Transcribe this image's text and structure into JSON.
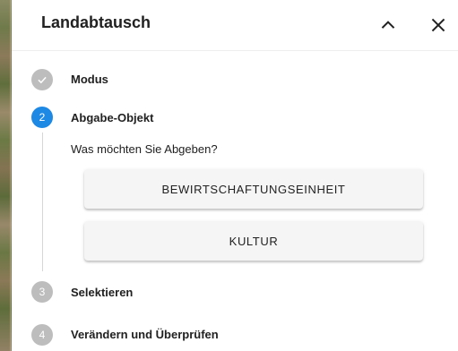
{
  "panel": {
    "title": "Landabtausch"
  },
  "header_icons": {
    "collapse": "chevron-up-icon",
    "close": "close-icon"
  },
  "stepper": {
    "steps": [
      {
        "marker": "",
        "icon": "check-icon",
        "label": "Modus",
        "state": "completed"
      },
      {
        "marker": "2",
        "label": "Abgabe-Objekt",
        "state": "active"
      },
      {
        "marker": "3",
        "label": "Selektieren",
        "state": "inactive"
      },
      {
        "marker": "4",
        "label": "Verändern und Überprüfen",
        "state": "inactive"
      }
    ],
    "active_content": {
      "question": "Was möchten Sie Abgeben?",
      "options": [
        "BEWIRTSCHAFTUNGSEINHEIT",
        "KULTUR"
      ]
    }
  },
  "colors": {
    "active_step": "#1e88e5",
    "inactive_step": "#bdbdbd",
    "button_bg": "#f5f5f5"
  }
}
